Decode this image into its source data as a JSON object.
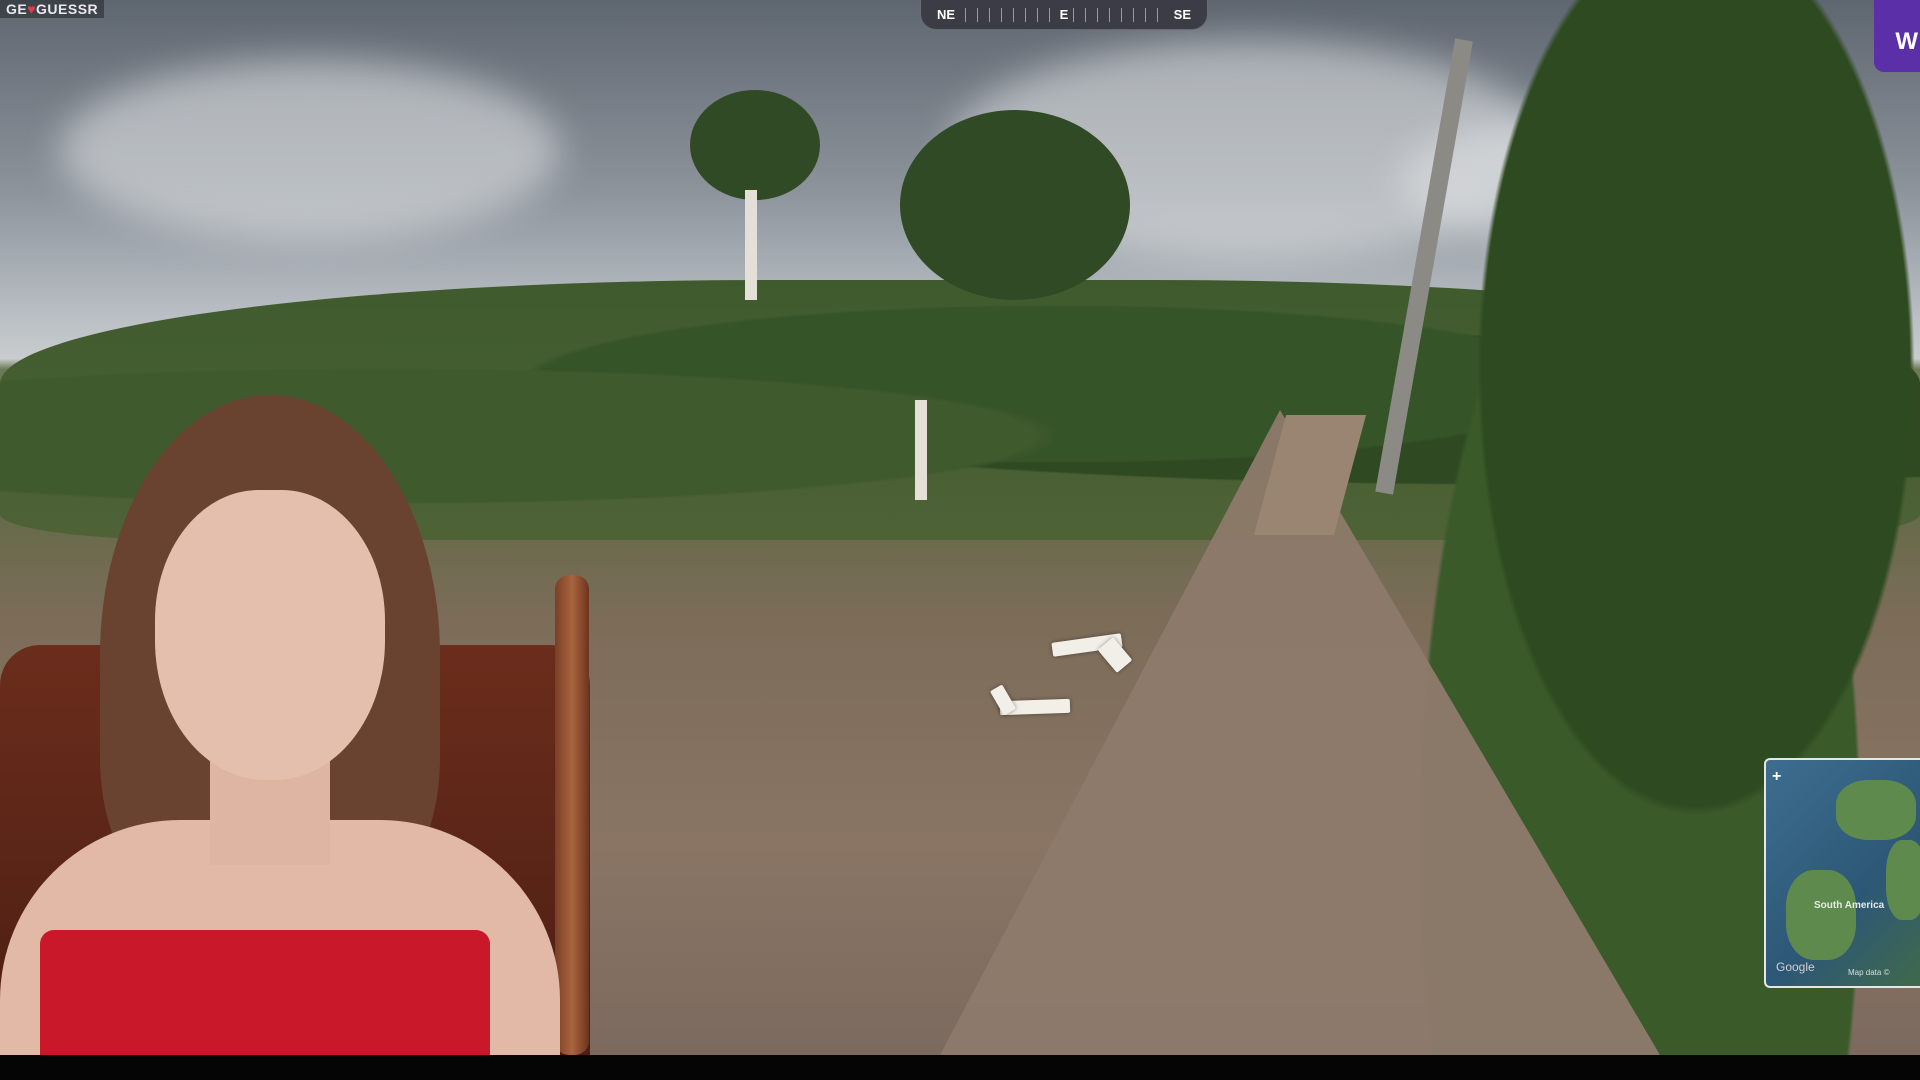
{
  "app": {
    "logo_left": "GE",
    "logo_heart": "♥",
    "logo_right": "GUESSR"
  },
  "compass": {
    "left": "NE",
    "center": "E",
    "right": "SE"
  },
  "badge": {
    "letter": "W"
  },
  "minimap": {
    "zoom_in": "+",
    "region_label": "South America",
    "provider": "Google",
    "map_data": "Map data ©"
  },
  "icons": {
    "zoom": "plus-icon",
    "nav": "chevron-arrow-icon"
  }
}
